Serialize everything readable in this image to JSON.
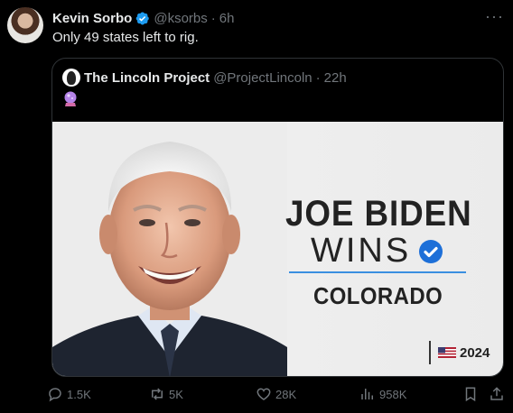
{
  "author": {
    "name": "Kevin Sorbo",
    "handle": "@ksorbs",
    "separator": "·",
    "time": "6h"
  },
  "more_icon": "more-horizontal-icon",
  "tweet_text": "Only 49 states left to rig.",
  "quoted": {
    "name": "The Lincoln Project",
    "handle": "@ProjectLincoln",
    "separator": "·",
    "time": "22h",
    "emoji_icon": "crystal-ball-icon",
    "image": {
      "headline_line1": "JOE BIDEN",
      "headline_line2": "WINS",
      "state": "COLORADO",
      "year": "2024",
      "accent_color": "#3a8fe0"
    }
  },
  "actions": {
    "replies": "1.5K",
    "reposts": "5K",
    "likes": "28K",
    "views": "958K"
  },
  "colors": {
    "background": "#000000",
    "text": "#e7e9ea",
    "muted": "#71767b",
    "verified": "#1d9bf0",
    "border": "#2f3336"
  }
}
